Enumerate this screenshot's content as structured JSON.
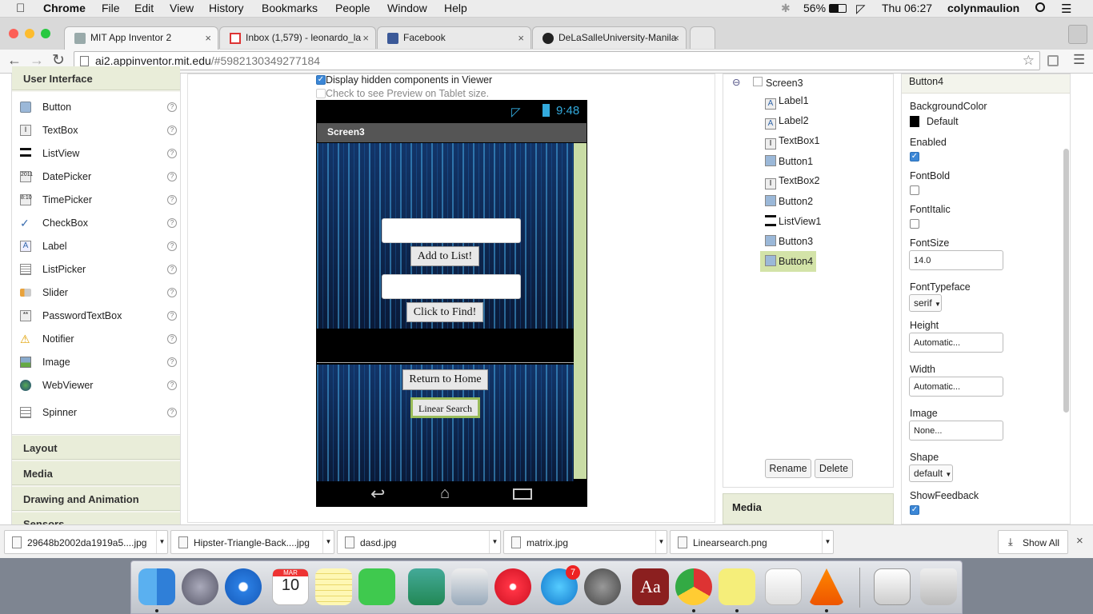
{
  "menubar": {
    "app": "Chrome",
    "items": [
      "File",
      "Edit",
      "View",
      "History",
      "Bookmarks",
      "People",
      "Window",
      "Help"
    ],
    "battery": "56%",
    "clock": "Thu 06:27",
    "user": "colynmaulion"
  },
  "tabs": [
    {
      "label": "MIT App Inventor 2",
      "close": "×"
    },
    {
      "label": "Inbox (1,579) - leonardo_la",
      "close": "×"
    },
    {
      "label": "Facebook",
      "close": "×"
    },
    {
      "label": "DeLaSalleUniversity-Manila",
      "close": "×"
    }
  ],
  "url": {
    "host": "ai2.appinventor.mit.edu",
    "path": "/#5982130349277184"
  },
  "palette": {
    "header": "User Interface",
    "items": [
      "Button",
      "TextBox",
      "ListView",
      "DatePicker",
      "TimePicker",
      "CheckBox",
      "Label",
      "ListPicker",
      "Slider",
      "PasswordTextBox",
      "Notifier",
      "Image",
      "WebViewer",
      "Spinner"
    ],
    "help": "?",
    "sections": [
      "Layout",
      "Media",
      "Drawing and Animation",
      "Sensors"
    ]
  },
  "viewer": {
    "hidden_label": "Display hidden components in Viewer",
    "tablet_label": "Check to see Preview on Tablet size.",
    "phone_time": "9:48",
    "screen_title": "Screen3",
    "btn_add": "Add to List!",
    "btn_find": "Click to Find!",
    "btn_return": "Return to Home",
    "btn_linear": "Linear Search"
  },
  "tree": {
    "root": "Screen3",
    "collapse": "⊖",
    "nodes": [
      "Label1",
      "Label2",
      "TextBox1",
      "Button1",
      "TextBox2",
      "Button2",
      "ListView1",
      "Button3",
      "Button4"
    ],
    "selected": "Button4",
    "rename": "Rename",
    "delete": "Delete",
    "media": "Media"
  },
  "props": {
    "title": "Button4",
    "bg_label": "BackgroundColor",
    "bg_value": "Default",
    "enabled": "Enabled",
    "fontbold": "FontBold",
    "fontitalic": "FontItalic",
    "fontsize": "FontSize",
    "fontsize_value": "14.0",
    "typeface": "FontTypeface",
    "typeface_value": "serif",
    "height": "Height",
    "height_value": "Automatic...",
    "width": "Width",
    "width_value": "Automatic...",
    "image": "Image",
    "image_value": "None...",
    "shape": "Shape",
    "shape_value": "default",
    "showfeedback": "ShowFeedback"
  },
  "downloads": {
    "files": [
      "29648b2002da1919a5....jpg",
      "Hipster-Triangle-Back....jpg",
      "dasd.jpg",
      "matrix.jpg",
      "Linearsearch.png"
    ],
    "show_all": "Show All",
    "close": "×"
  },
  "dock": {
    "calendar_month": "MAR",
    "calendar_day": "10",
    "appstore_badge": "7"
  },
  "colors": {
    "accent": "#c9dca5",
    "palette_header": "#e9edd9",
    "selected_row": "#d3e3a8"
  }
}
